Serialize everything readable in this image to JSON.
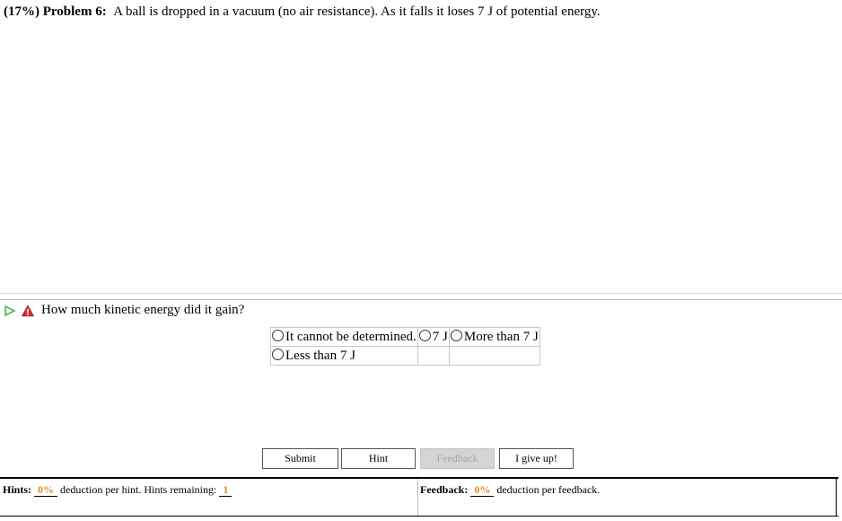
{
  "problem": {
    "percent": "(17%)",
    "number": "Problem 6:",
    "statement": "A ball is dropped in a vacuum (no air resistance). As it falls it loses 7 J of potential energy."
  },
  "question": {
    "text": "How much kinetic energy did it gain?"
  },
  "choices": [
    "It cannot be determined.",
    "7 J",
    "More than 7 J",
    "Less than 7 J"
  ],
  "buttons": {
    "submit": "Submit",
    "hint": "Hint",
    "feedback": "Feedback",
    "give_up": "I give up!"
  },
  "footer": {
    "hints_label": "Hints:",
    "hints_deduction": "0%",
    "hints_text": "deduction per hint. Hints remaining:",
    "hints_remaining": "1",
    "feedback_label": "Feedback:",
    "feedback_deduction": "0%",
    "feedback_text": "deduction per feedback."
  },
  "colors": {
    "play_icon": "#4caf50",
    "warning_icon": "#d32f2f",
    "deduction_value": "#e08a2c"
  }
}
